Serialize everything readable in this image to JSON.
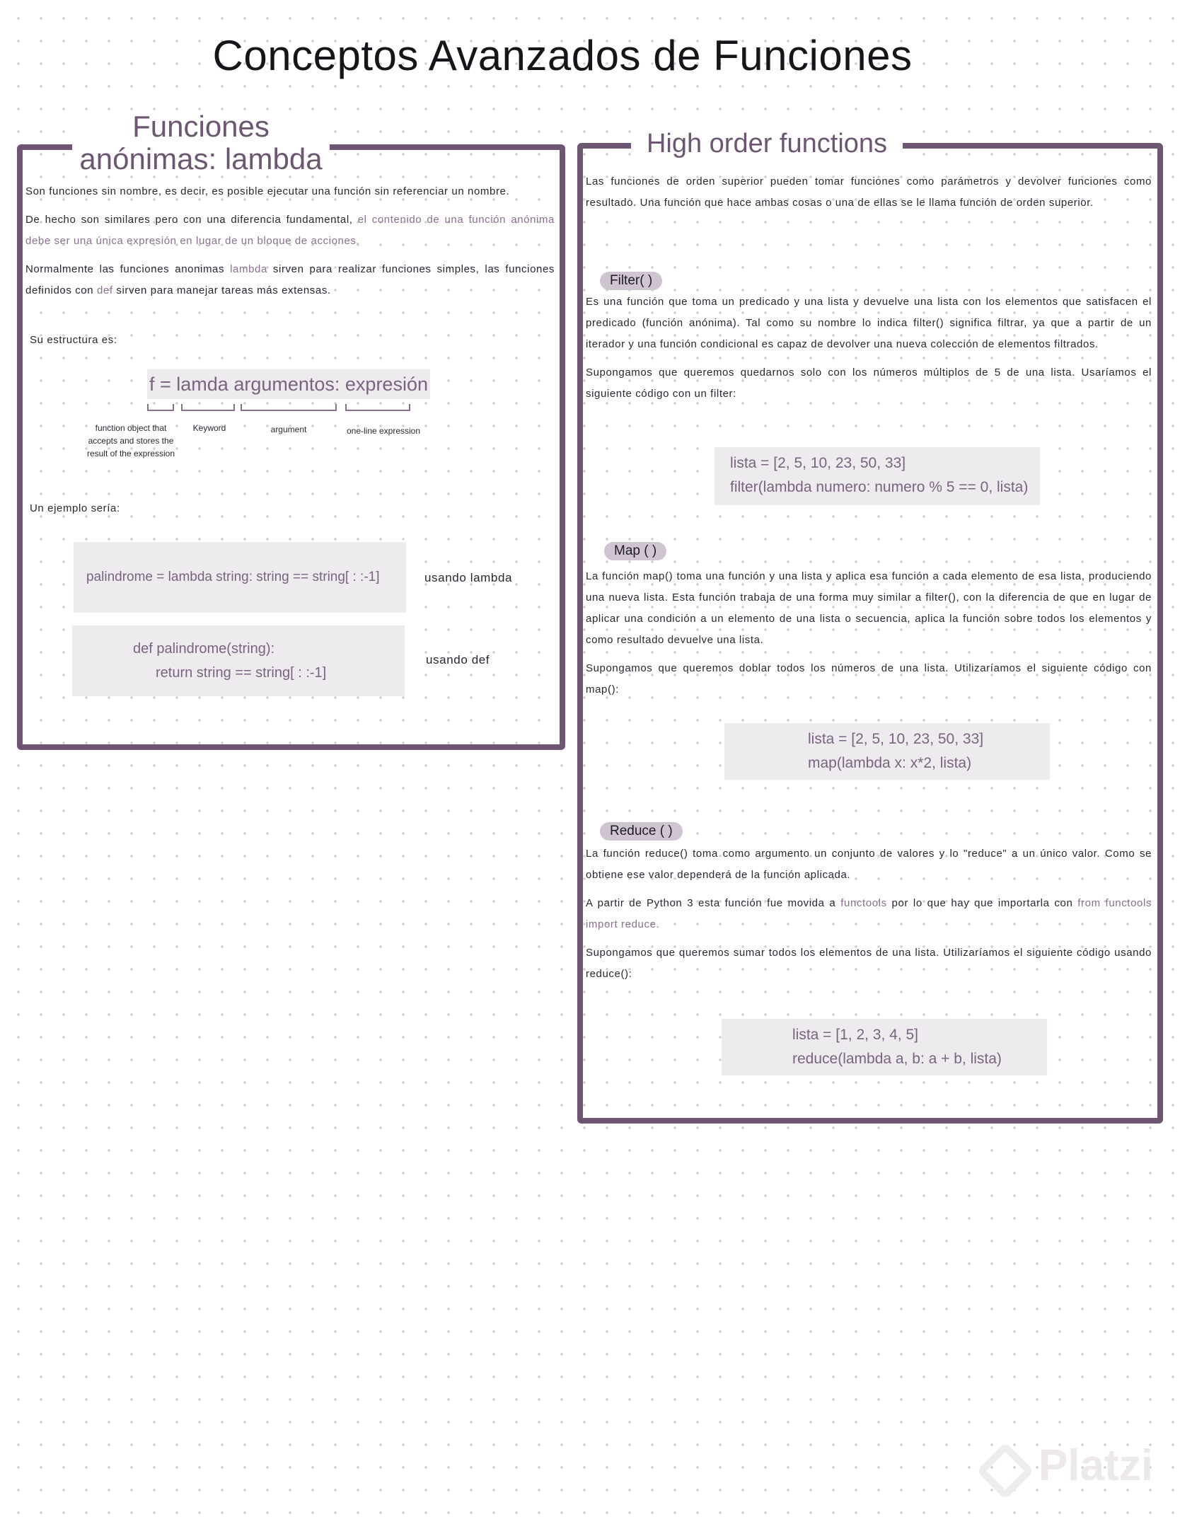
{
  "title": "Conceptos Avanzados de Funciones",
  "left": {
    "heading_line1": "Funciones",
    "heading_line2": "anónimas: lambda",
    "p1": "Son funciones sin nombre, es decir, es posible ejecutar una función sin referenciar un nombre.",
    "p2_a": "De hecho son similares pero con una diferencia fundamental, ",
    "p2_b": "el contenido de una función anónima debe ser una única expresión en lugar de un bloque de acciones.",
    "p3_a": "Normalmente las funciones anonimas ",
    "p3_lambda": "lambda",
    "p3_b": " sirven para realizar funciones simples, las funciones definidos con ",
    "p3_def": "def",
    "p3_c": " sirven para manejar tareas más extensas.",
    "estructura_label": "Su estructura es:",
    "syntax": "f = lamda argumentos: expresión",
    "ann_f": "function object that accepts and stores the result of the expression",
    "ann_keyword": "Keyword",
    "ann_argument": "argument",
    "ann_expression": "one-line expression",
    "ejemplo_label": "Un ejemplo sería:",
    "code_lambda": "palindrome = lambda string: string == string[ : :-1]",
    "label_lambda": "usando lambda",
    "code_def_1": "def palindrome(string):",
    "code_def_2": "return string == string[ : :-1]",
    "label_def": "usando def"
  },
  "right": {
    "heading": "High order functions",
    "intro": "Las funciones de orden superior pueden tomar funciones como parámetros y devolver funciones como resultado. Una función que hace ambas cosas o una de ellas se le llama función de orden superior.",
    "filter": {
      "label": "Filter( )",
      "p1": "Es una función que toma un predicado y una lista y devuelve una lista con los elementos que satisfacen el predicado (función anónima). Tal como su nombre lo indica filter() significa filtrar, ya que a partir de un iterador y una función condicional es capaz de devolver una nueva colección de elementos filtrados.",
      "p2": "Supongamos que queremos quedarnos solo con los números múltiplos de 5 de una lista. Usaríamos el siguiente código con un filter:",
      "code_1": "lista = [2, 5, 10, 23, 50, 33]",
      "code_2": "filter(lambda numero: numero % 5 == 0, lista)"
    },
    "map": {
      "label": "Map ( )",
      "p1": "La función map() toma una función y una lista y aplica esa función a cada elemento de esa lista, produciendo una nueva lista. Esta función trabaja de una forma muy similar a filter(), con la diferencia de que en lugar de aplicar una condición a un elemento de una lista o secuencia, aplica la función sobre todos los elementos y como resultado devuelve una lista.",
      "p2": "Supongamos que queremos doblar todos los números de una lista. Utilizaríamos el siguiente código con map():",
      "code_1": "lista = [2, 5, 10, 23, 50, 33]",
      "code_2": "map(lambda x: x*2, lista)"
    },
    "reduce": {
      "label": "Reduce ( )",
      "p1": "La función reduce() toma como argumento un conjunto de valores y lo \"reduce\" a un único valor. Como se obtiene ese valor dependerá de la función aplicada.",
      "p2_a": "A partir de Python 3 esta función fue movida a ",
      "p2_functools": "functools",
      "p2_b": " por lo que hay que importarla con ",
      "p2_import": "from functools import reduce.",
      "p3": "Supongamos que queremos sumar todos los elementos de una lista. Utilizaríamos el siguiente código usando reduce():",
      "code_1": "lista = [1, 2, 3, 4, 5]",
      "code_2": "reduce(lambda a, b: a + b, lista)"
    }
  },
  "watermark": "Platzi"
}
